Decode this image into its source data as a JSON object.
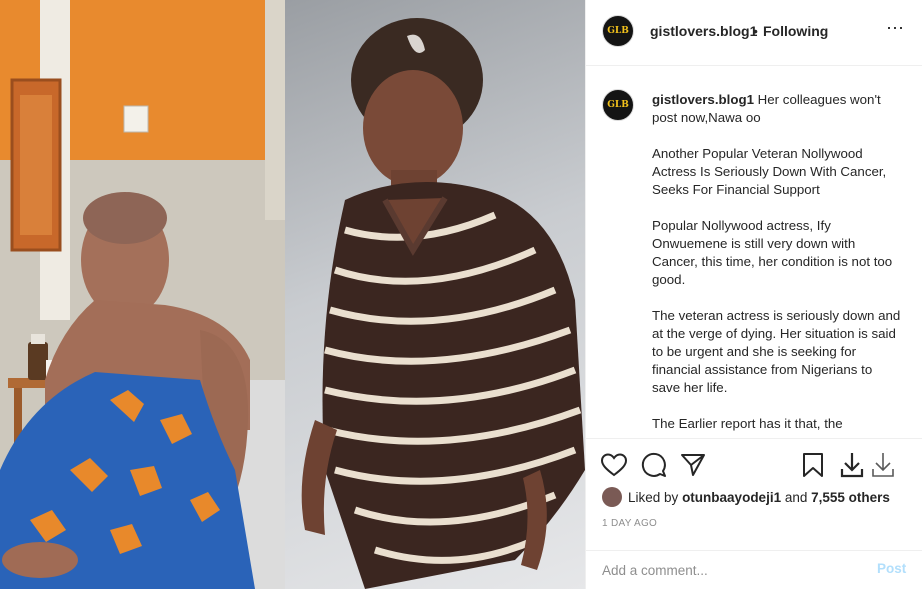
{
  "post": {
    "username": "gistlovers.blog1",
    "avatar_initials": "GLB",
    "separator": "•",
    "follow_status": "Following",
    "more_icon": "⋯"
  },
  "caption": {
    "username": "gistlovers.blog1",
    "intro": "Her colleagues won't post now,Nawa oo",
    "paragraphs": [
      "Another Popular Veteran Nollywood Actress Is Seriously Down With Cancer, Seeks For Financial Support",
      "Popular Nollywood actress, Ify Onwuemene is still very down with Cancer, this time, her condition is not too good.",
      "The veteran actress is seriously down and at the verge of dying. Her situation is said to be urgent and she is seeking for financial assistance from Nigerians to save her life.",
      "The Earlier report has it that, the"
    ]
  },
  "actions": {
    "icons": [
      "heart-icon",
      "comment-icon",
      "share-icon",
      "bookmark-icon",
      "download-icon",
      "download-alt-icon"
    ]
  },
  "likes": {
    "prefix": "Liked by",
    "user": "otunbaayodeji1",
    "connector": "and",
    "count": "7,555 others"
  },
  "timestamp": "1 DAY AGO",
  "comment": {
    "placeholder": "Add a comment...",
    "post_label": "Post"
  },
  "colors": {
    "border": "#efefef",
    "muted": "#8e8e8e",
    "post_disabled": "#b2dffc",
    "wall_orange": "#e88a2e",
    "fabric_blue": "#2a63b8"
  }
}
